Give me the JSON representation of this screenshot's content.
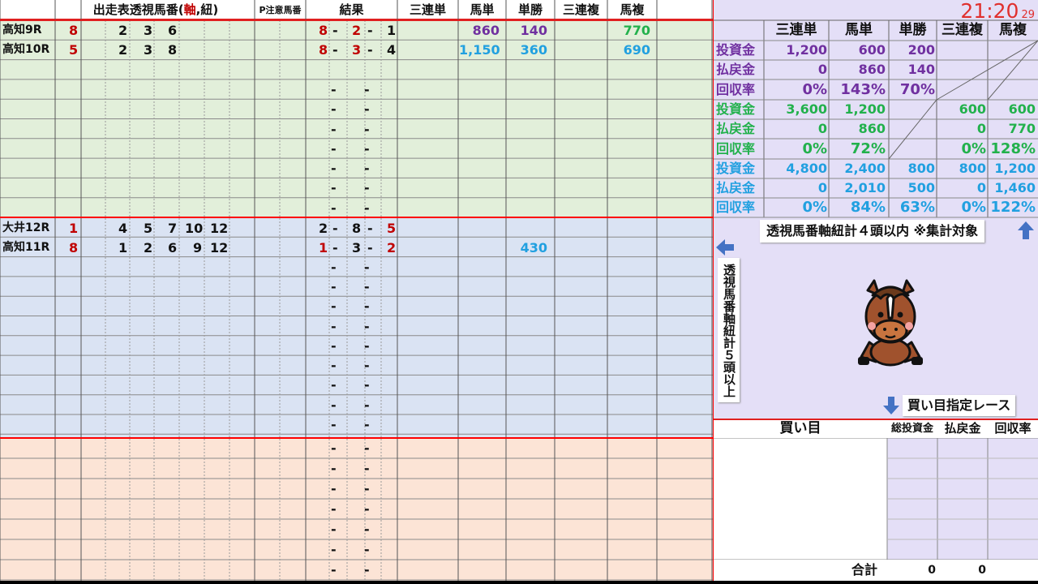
{
  "header": {
    "entries_title": "出走表透視馬番(軸,紐)",
    "entries_title_pre": "出走表透視馬番(",
    "entries_title_axis": "軸",
    "entries_title_mid": ",紐)",
    "caution_label": "P注意馬番",
    "result_label": "結果",
    "bet_types": [
      "三連単",
      "馬単",
      "単勝",
      "三連複",
      "馬複"
    ]
  },
  "clock": {
    "time": "21:20",
    "seconds": "29"
  },
  "green_rows": [
    {
      "race": "高知9R",
      "axis": "8",
      "sub": [
        "2",
        "3",
        "6"
      ],
      "r1": "8",
      "r2": "2",
      "r3": "1",
      "sanrentan": "",
      "umatan": "860",
      "tansho": "140",
      "sanrenpuku": "",
      "umafuku": "770"
    },
    {
      "race": "高知10R",
      "axis": "5",
      "sub": [
        "2",
        "3",
        "8"
      ],
      "r1": "8",
      "r2": "3",
      "r3": "4",
      "sanrentan": "",
      "umatan": "1,150",
      "tansho": "360",
      "sanrenpuku": "",
      "umafuku": "690"
    }
  ],
  "blue_rows": [
    {
      "race": "大井12R",
      "axis": "1",
      "sub": [
        "4",
        "5",
        "7",
        "10",
        "12"
      ],
      "r1": "2",
      "r2": "8",
      "r3": "5",
      "tansho": ""
    },
    {
      "race": "高知11R",
      "axis": "8",
      "sub": [
        "1",
        "2",
        "6",
        "9",
        "12"
      ],
      "r1": "1",
      "r2": "3",
      "r3": "2",
      "tansho": "430"
    }
  ],
  "summary": {
    "headers": [
      "三連単",
      "馬単",
      "単勝",
      "三連複",
      "馬複"
    ],
    "purple": {
      "labels": [
        "投資金",
        "払戻金",
        "回収率"
      ],
      "sanrentan": [
        "1,200",
        "0",
        "0%"
      ],
      "umatan": [
        "600",
        "860",
        "143%"
      ],
      "tansho": [
        "200",
        "140",
        "70%"
      ]
    },
    "green": {
      "labels": [
        "投資金",
        "払戻金",
        "回収率"
      ],
      "sanrentan": [
        "3,600",
        "0",
        "0%"
      ],
      "umatan": [
        "1,200",
        "860",
        "72%"
      ],
      "sanrenpuku": [
        "600",
        "0",
        "0%"
      ],
      "umafuku": [
        "600",
        "770",
        "128%"
      ]
    },
    "sky": {
      "labels": [
        "投資金",
        "払戻金",
        "回収率"
      ],
      "sanrentan": [
        "4,800",
        "0",
        "0%"
      ],
      "umatan": [
        "2,400",
        "2,010",
        "84%"
      ],
      "tansho": [
        "800",
        "500",
        "63%"
      ],
      "sanrenpuku": [
        "800",
        "0",
        "0%"
      ],
      "umafuku": [
        "1,200",
        "1,460",
        "122%"
      ]
    }
  },
  "notes": {
    "four_or_less": "透視馬番軸紐計４頭以内 ※集計対象",
    "five_or_more": "透視馬番軸紐計５頭以上",
    "designated": "買い目指定レース"
  },
  "bottom_table": {
    "headers": [
      "買い目",
      "総投資金",
      "払戻金",
      "回収率"
    ],
    "total_label": "合計",
    "total_invest": "0",
    "total_payout": "0"
  },
  "colors": {
    "green_bg": "#e2efda",
    "blue_bg": "#dae3f3",
    "pink_bg": "#fce4d6",
    "purple_bg": "#e4dff7",
    "divider_red": "#ff0000",
    "arrow_blue": "#4472c4"
  }
}
